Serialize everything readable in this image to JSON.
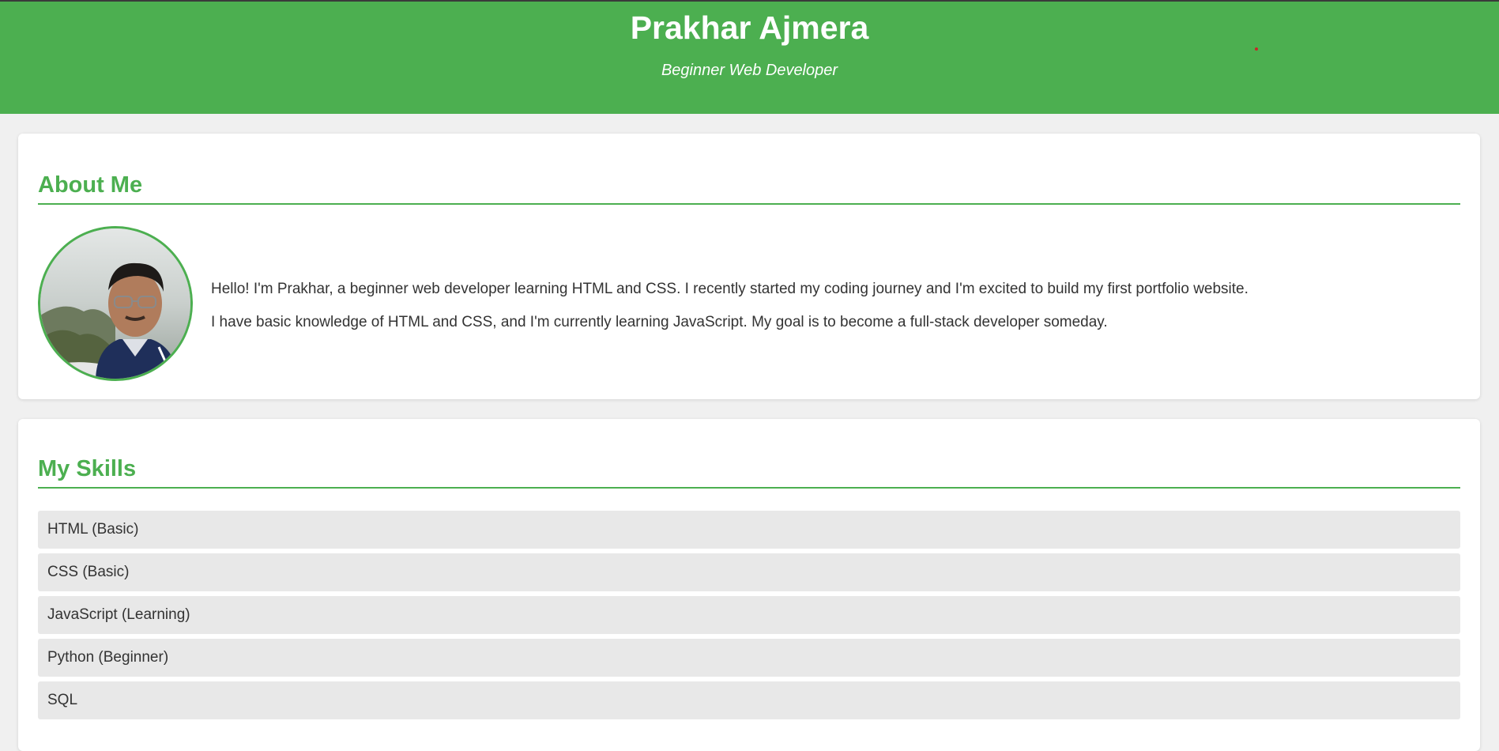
{
  "header": {
    "name": "Prakhar Ajmera",
    "tagline": "Beginner Web Developer"
  },
  "about": {
    "title": "About Me",
    "paragraphs": [
      "Hello! I'm Prakhar, a beginner web developer learning HTML and CSS. I recently started my coding journey and I'm excited to build my first portfolio website.",
      "I have basic knowledge of HTML and CSS, and I'm currently learning JavaScript. My goal is to become a full-stack developer someday."
    ]
  },
  "skills": {
    "title": "My Skills",
    "items": [
      "HTML (Basic)",
      "CSS (Basic)",
      "JavaScript (Learning)",
      "Python (Beginner)",
      "SQL"
    ]
  },
  "colors": {
    "accent": "#4caf50",
    "page_bg": "#f0f0f0",
    "skill_bg": "#e8e8e8",
    "text": "#333333"
  }
}
